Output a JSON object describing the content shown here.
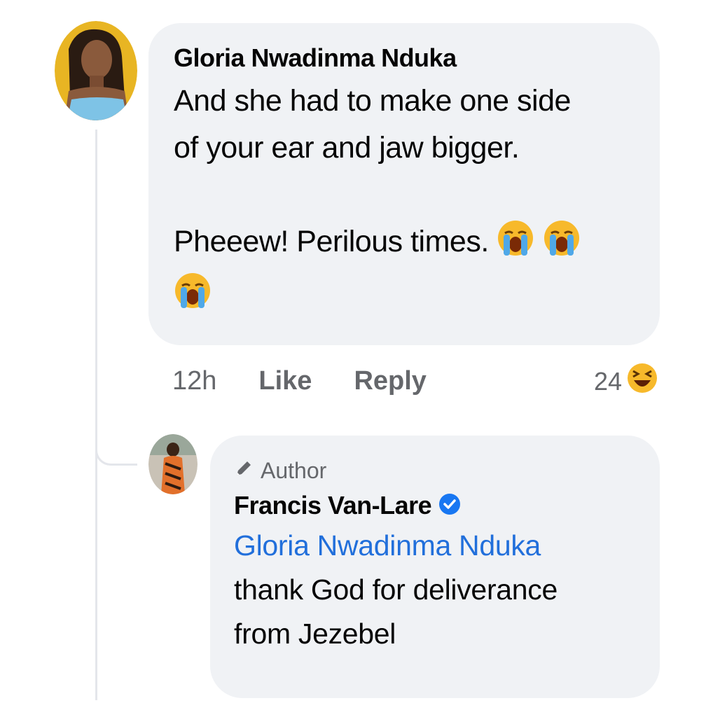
{
  "comment": {
    "author": "Gloria Nwadinma Nduka",
    "line1": "And she had to make one side",
    "line2": "of your ear and jaw bigger.",
    "line3": "Pheeew! Perilous times.",
    "emoji": "loudly-crying-face",
    "time": "12h",
    "like_label": "Like",
    "reply_label": "Reply",
    "reaction_count": "24",
    "reaction_emoji": "laughing-face"
  },
  "reply": {
    "badge": "Author",
    "author": "Francis Van-Lare",
    "verified": true,
    "mention": "Gloria Nwadinma Nduka",
    "line1": "thank God for deliverance",
    "line2": "from Jezebel"
  },
  "colors": {
    "bubble": "#f0f2f5",
    "meta_text": "#65676b",
    "mention": "#216fdb",
    "verified_badge": "#1877f2"
  }
}
